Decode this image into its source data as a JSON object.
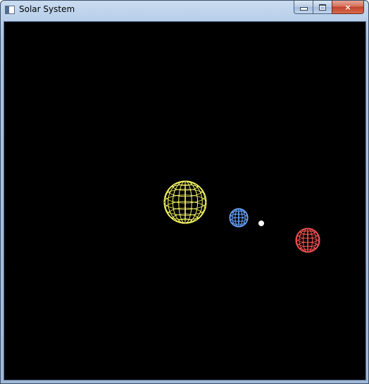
{
  "window": {
    "title": "Solar System",
    "buttons": {
      "minimize": "minimize",
      "maximize": "maximize",
      "close": "×"
    }
  },
  "scene": {
    "background": "#000000",
    "bodies": [
      {
        "name": "sun",
        "color": "#ffff66",
        "style": "wireframe-sphere"
      },
      {
        "name": "planet-blue",
        "color": "#6aa5ff",
        "style": "wireframe-sphere"
      },
      {
        "name": "moon-white",
        "color": "#ffffff",
        "style": "solid-point"
      },
      {
        "name": "planet-red",
        "color": "#ff5555",
        "style": "wireframe-sphere"
      }
    ]
  }
}
